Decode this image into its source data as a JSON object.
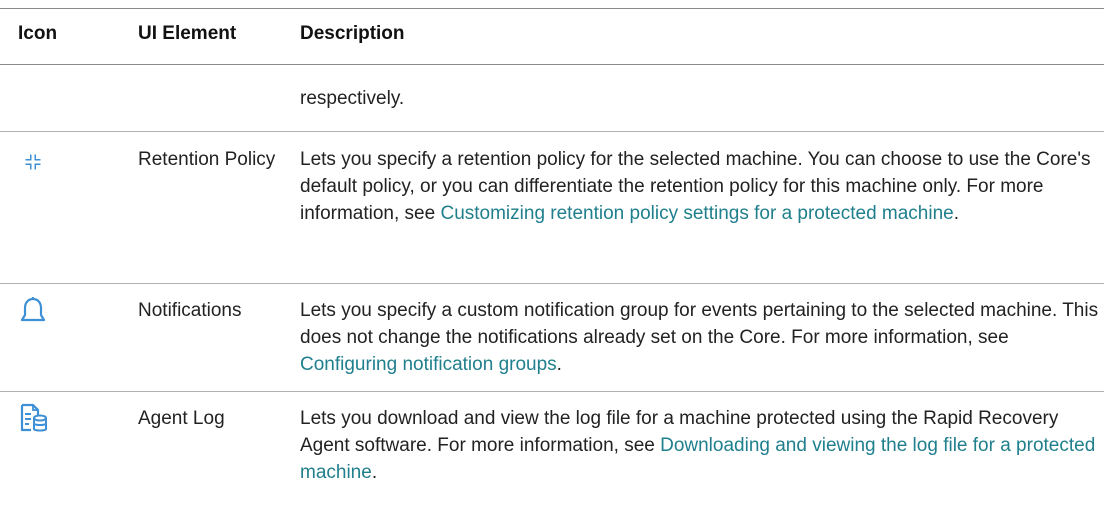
{
  "table": {
    "headers": [
      "Icon",
      "UI Element",
      "Description"
    ],
    "rows": [
      {
        "icon": "",
        "element": "",
        "description": {
          "text": "respectively."
        }
      },
      {
        "icon": "retention-arrows-icon",
        "element": "Retention Policy",
        "description": {
          "text": "Lets you specify a retention policy for the selected machine. You can choose to use the Core's default policy, or you can differentiate the retention policy for this machine only. For more information, see ",
          "link": "Customizing retention policy settings for a protected machine",
          "end": "."
        }
      },
      {
        "icon": "bell-icon",
        "element": "Notifications",
        "description": {
          "text": "Lets you specify a custom notification group for events pertaining to the selected machine. This does not change the notifications already set on the Core. For more information, see ",
          "link": "Configuring notification groups",
          "end": "."
        }
      },
      {
        "icon": "log-file-icon",
        "element": "Agent Log",
        "description": {
          "text": "Lets you download and view the log file for a machine protected using the Rapid Recovery Agent software. For more information, see ",
          "link": "Downloading and viewing the log file for a protected machine",
          "end": "."
        }
      }
    ]
  },
  "colors": {
    "icon": "#3d8fd6",
    "link": "#1f7f8c",
    "rule": "#b0b0b0"
  }
}
